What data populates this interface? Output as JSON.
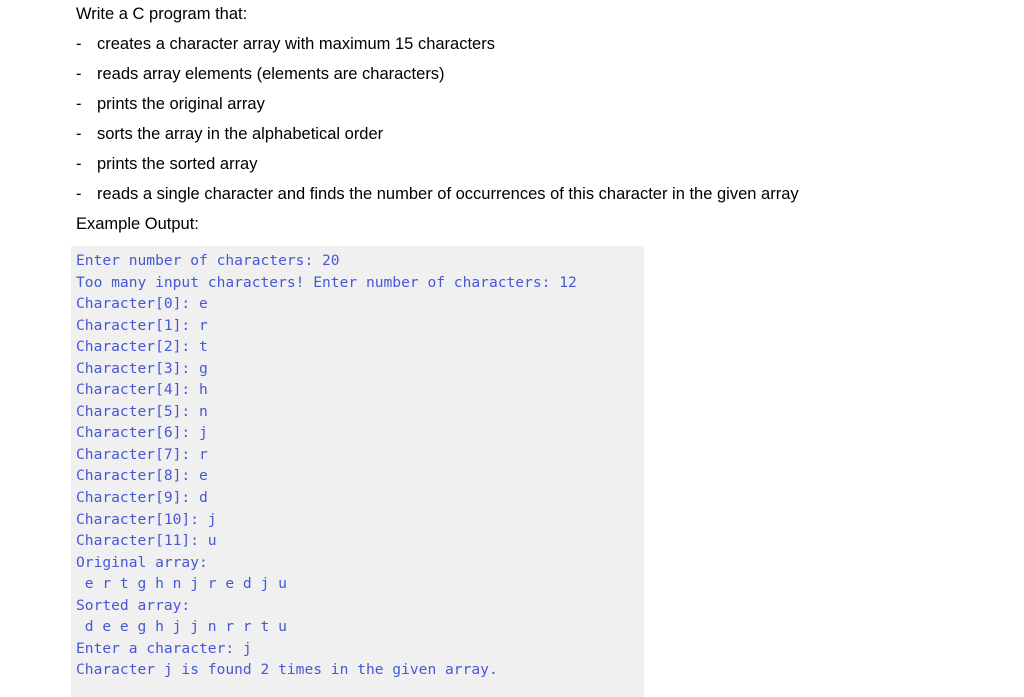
{
  "question": {
    "intro": "Write a C program that:",
    "requirements": [
      {
        "bullet": "-",
        "text": "creates a character array with maximum 15 characters"
      },
      {
        "bullet": "-",
        "text": "reads array elements (elements are characters)"
      },
      {
        "bullet": "-",
        "text": "prints the original array"
      },
      {
        "bullet": "-",
        "text": "sorts the array in the alphabetical order"
      },
      {
        "bullet": "-",
        "text": "prints the sorted array"
      },
      {
        "bullet": "-",
        "text": "reads a single character and finds the number of occurrences of this character in the given array"
      }
    ],
    "example_label": "Example Output:"
  },
  "console": {
    "background_color": "#f0f0f0",
    "text_color": "#4657d8",
    "lines": [
      "Enter number of characters: 20",
      "Too many input characters! Enter number of characters: 12",
      "Character[0]: e",
      "Character[1]: r",
      "Character[2]: t",
      "Character[3]: g",
      "Character[4]: h",
      "Character[5]: n",
      "Character[6]: j",
      "Character[7]: r",
      "Character[8]: e",
      "Character[9]: d",
      "Character[10]: j",
      "Character[11]: u",
      "Original array:",
      " e r t g h n j r e d j u",
      "Sorted array:",
      " d e e g h j j n r r t u",
      "Enter a character: j",
      "Character j is found 2 times in the given array."
    ]
  }
}
